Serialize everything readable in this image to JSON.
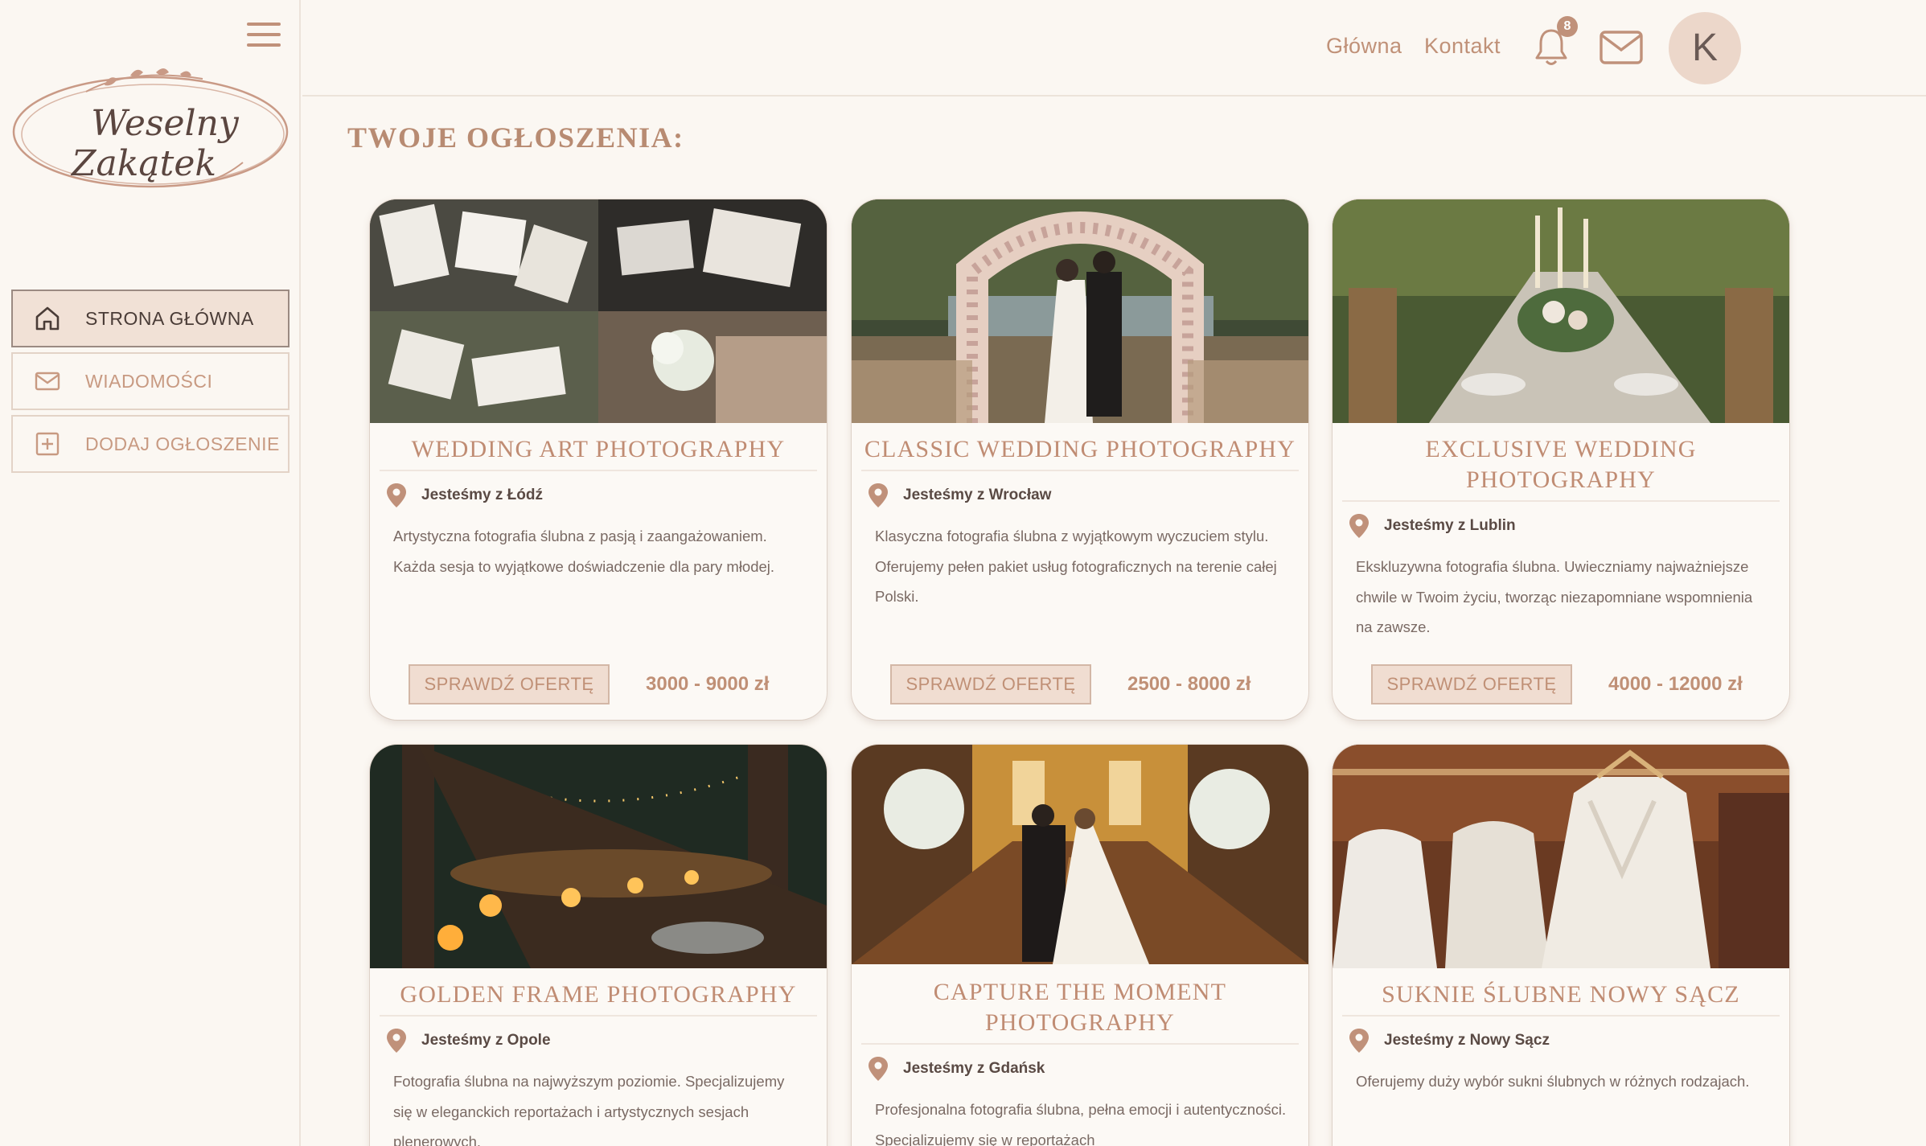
{
  "brand": {
    "line1": "Weselny",
    "line2": "Zakątek"
  },
  "sidebar": {
    "items": [
      {
        "label": "STRONA GŁÓWNA",
        "icon": "home-icon",
        "active": true
      },
      {
        "label": "WIADOMOŚCI",
        "icon": "mail-icon",
        "active": false
      },
      {
        "label": "DODAJ OGŁOSZENIE",
        "icon": "plus-square-icon",
        "active": false
      }
    ]
  },
  "header": {
    "links": [
      {
        "label": "Główna"
      },
      {
        "label": "Kontakt"
      }
    ],
    "notifications": {
      "count": "8",
      "icon": "bell-icon"
    },
    "messages_icon": "mail-icon",
    "avatar_initial": "K"
  },
  "page_title": "TWOJE OGŁOSZENIA:",
  "offer_button_label": "SPRAWDŹ OFERTĘ",
  "colors": {
    "accent": "#c0917a",
    "active_bg": "#f1e1d6",
    "background": "#fbf7f2"
  },
  "cards": [
    {
      "title": "WEDDING ART PHOTOGRAPHY",
      "location": "Jesteśmy z Łódź",
      "description": "Artystyczna fotografia ślubna z pasją i zaangażowaniem. Każda sesja to wyjątkowe doświadczenie dla pary młodej.",
      "price": "3000 - 9000 zł"
    },
    {
      "title": "CLASSIC WEDDING PHOTOGRAPHY",
      "location": "Jesteśmy z Wrocław",
      "description": "Klasyczna fotografia ślubna z wyjątkowym wyczuciem stylu. Oferujemy pełen pakiet usług fotograficznych na terenie całej Polski.",
      "price": "2500 - 8000 zł"
    },
    {
      "title": "EXCLUSIVE WEDDING PHOTOGRAPHY",
      "location": "Jesteśmy z Lublin",
      "description": "Ekskluzywna fotografia ślubna. Uwieczniamy najważniejsze chwile w Twoim życiu, tworząc niezapomniane wspomnienia na zawsze.",
      "price": "4000 - 12000 zł"
    },
    {
      "title": "GOLDEN FRAME PHOTOGRAPHY",
      "location": "Jesteśmy z Opole",
      "description": "Fotografia ślubna na najwyższym poziomie. Specjalizujemy się w eleganckich reportażach i artystycznych sesjach plenerowych.",
      "price": ""
    },
    {
      "title": "CAPTURE THE MOMENT PHOTOGRAPHY",
      "location": "Jesteśmy z Gdańsk",
      "description": "Profesjonalna fotografia ślubna, pełna emocji i autentyczności. Specjalizujemy się w reportażach",
      "price": ""
    },
    {
      "title": "SUKNIE ŚLUBNE NOWY SĄCZ",
      "location": "Jesteśmy z Nowy Sącz",
      "description": "Oferujemy duży wybór sukni ślubnych w różnych rodzajach.",
      "price": ""
    }
  ]
}
